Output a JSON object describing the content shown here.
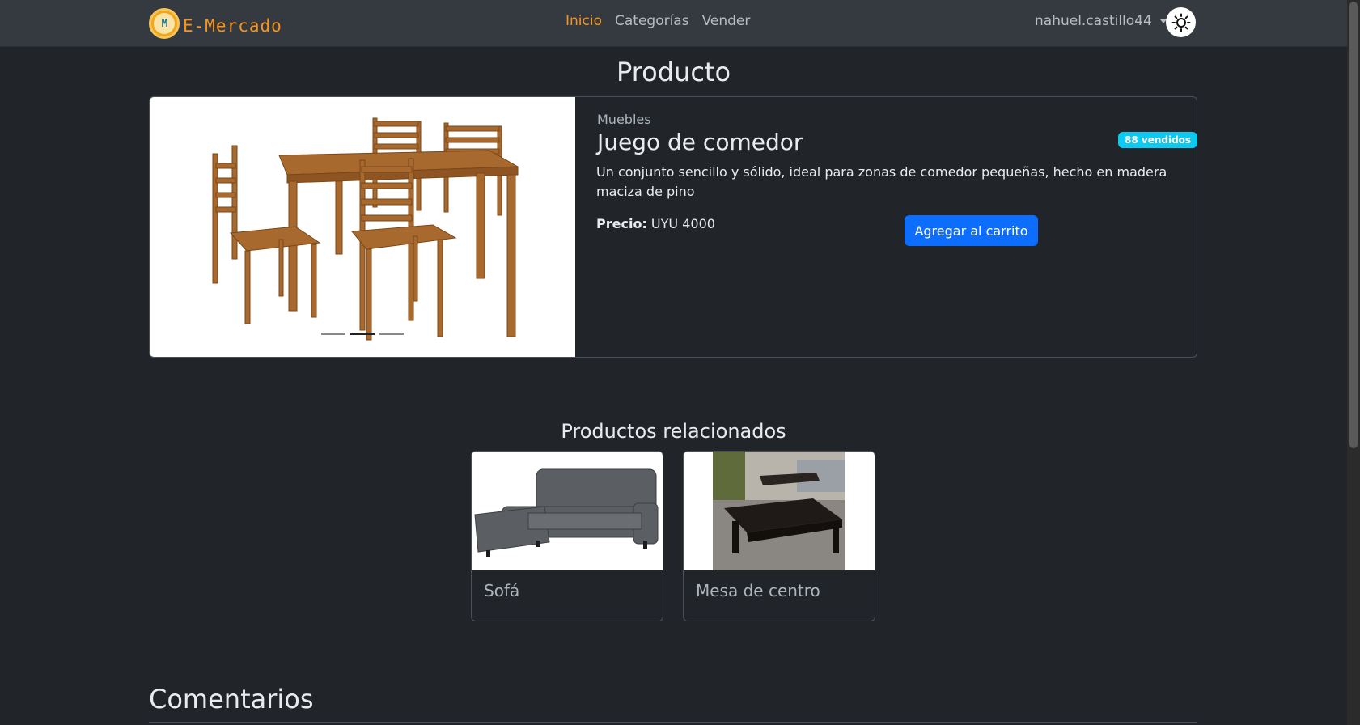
{
  "navbar": {
    "brand_text": "E-Mercado",
    "brand_logo_letters": "M",
    "links": [
      {
        "label": "Inicio",
        "active": true
      },
      {
        "label": "Categorías",
        "active": false
      },
      {
        "label": "Vender",
        "active": false
      }
    ],
    "username": "nahuel.castillo44",
    "theme_icon": "sun-icon"
  },
  "page": {
    "title": "Producto"
  },
  "product": {
    "category": "Muebles",
    "name": "Juego de comedor",
    "sold_badge": "88 vendidos",
    "description": "Un conjunto sencillo y sólido, ideal para zonas de comedor pequeñas, hecho en madera maciza de pino",
    "price_label": "Precio:",
    "price_value": "UYU 4000",
    "cart_button": "Agregar al carrito",
    "carousel_slides": 3,
    "carousel_active": 2
  },
  "related": {
    "title": "Productos relacionados",
    "items": [
      {
        "name": "Sofá"
      },
      {
        "name": "Mesa de centro"
      }
    ]
  },
  "comments": {
    "title": "Comentarios"
  },
  "colors": {
    "accent": "#f7941d",
    "primary": "#0d6efd",
    "badge": "#0dcaf0",
    "background": "#212529"
  }
}
